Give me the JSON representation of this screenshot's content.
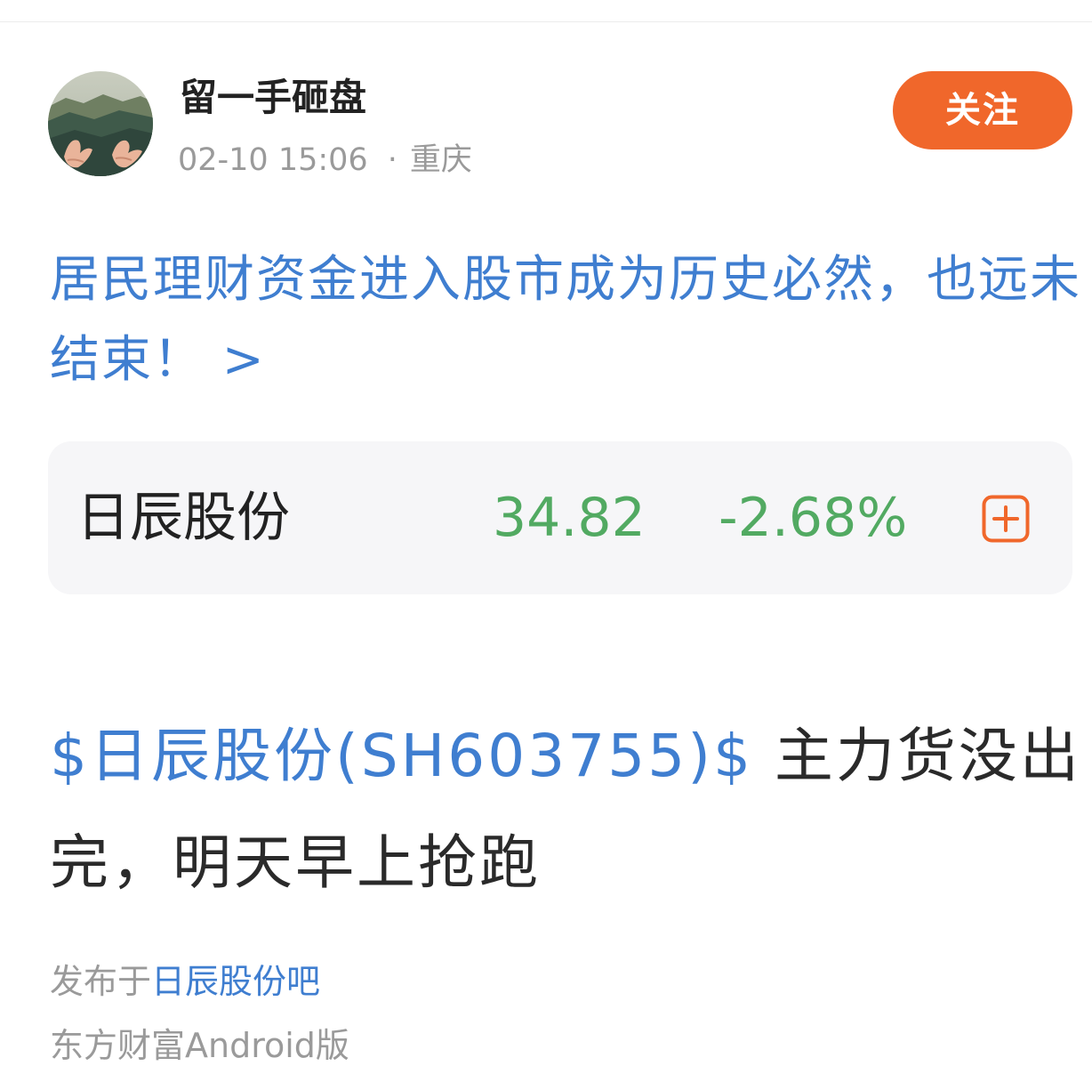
{
  "author": {
    "name": "留一手砸盘",
    "date": "02-10 15:06",
    "separator": "·",
    "location": "重庆",
    "avatar_icon": "landscape-hands-avatar-icon"
  },
  "follow_button": {
    "label": "关注",
    "color": "#f0672b"
  },
  "title": {
    "text": "居民理财资金进入股市成为历史必然，也远未结束！ >",
    "color": "#3f7ed0"
  },
  "stock_card": {
    "name": "日辰股份",
    "price": "34.82",
    "change": "-2.68%",
    "price_color": "#52aa62",
    "add_icon": "plus-square-icon",
    "add_icon_color": "#f0672b"
  },
  "post": {
    "stock_tag": "$日辰股份(SH603755)$",
    "text": " 主力货没出完，明天早上抢跑"
  },
  "footer": {
    "published_prefix": "发布于",
    "forum": "日辰股份吧",
    "source": "东方财富Android版"
  }
}
